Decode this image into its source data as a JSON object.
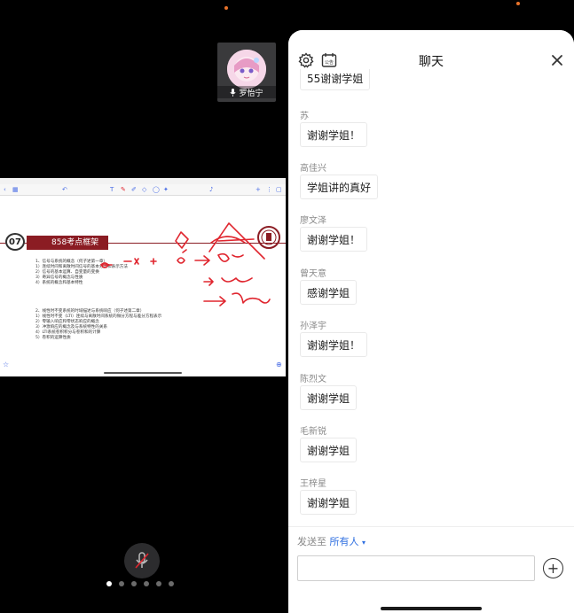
{
  "participant": {
    "name": "罗怡宁"
  },
  "shared_screen": {
    "slide_number": "07",
    "slide_title": "858考点框架",
    "slide_lines_a": [
      "1、信号与系统的概念（何子述第一章）",
      "1）连续时间和离散时间信号的基本分类和表示方法",
      "2）信号的基本运算、自变量的变换",
      "3）奇异信号的概念与性质",
      "4）系统的概念和基本特性"
    ],
    "slide_lines_b": [
      "2、线性时不变系统的时域描述与系统响应（何子述第二章）",
      "1）线性时不变（LTI）连续与离散时间系统的微分方程与差分方程表示",
      "2）零输入响应和零状态响应的概念",
      "3）冲激响应的概念及与系统特性的关系",
      "4）LTI系统卷积积分与卷积和的计算",
      "5）卷积的运算性质"
    ]
  },
  "chat": {
    "title": "聊天",
    "messages": [
      {
        "sender": "",
        "text": "55谢谢学姐"
      },
      {
        "sender": "苏",
        "text": "谢谢学姐！"
      },
      {
        "sender": "高佳兴",
        "text": "学姐讲的真好"
      },
      {
        "sender": "廖文泽",
        "text": "谢谢学姐！"
      },
      {
        "sender": "曾天意",
        "text": "感谢学姐"
      },
      {
        "sender": "孙泽宇",
        "text": "谢谢学姐！"
      },
      {
        "sender": "陈烈文",
        "text": "谢谢学姐"
      },
      {
        "sender": "毛新锐",
        "text": "谢谢学姐"
      },
      {
        "sender": "王梓星",
        "text": "谢谢学姐"
      }
    ],
    "send_to_label": "发送至",
    "send_to_target": "所有人",
    "input_placeholder": ""
  },
  "pager": {
    "count": 6,
    "active_index": 0
  },
  "colors": {
    "accent": "#2f6fe0",
    "slide_red": "#8b1c23",
    "ink_red": "#e0262f"
  }
}
